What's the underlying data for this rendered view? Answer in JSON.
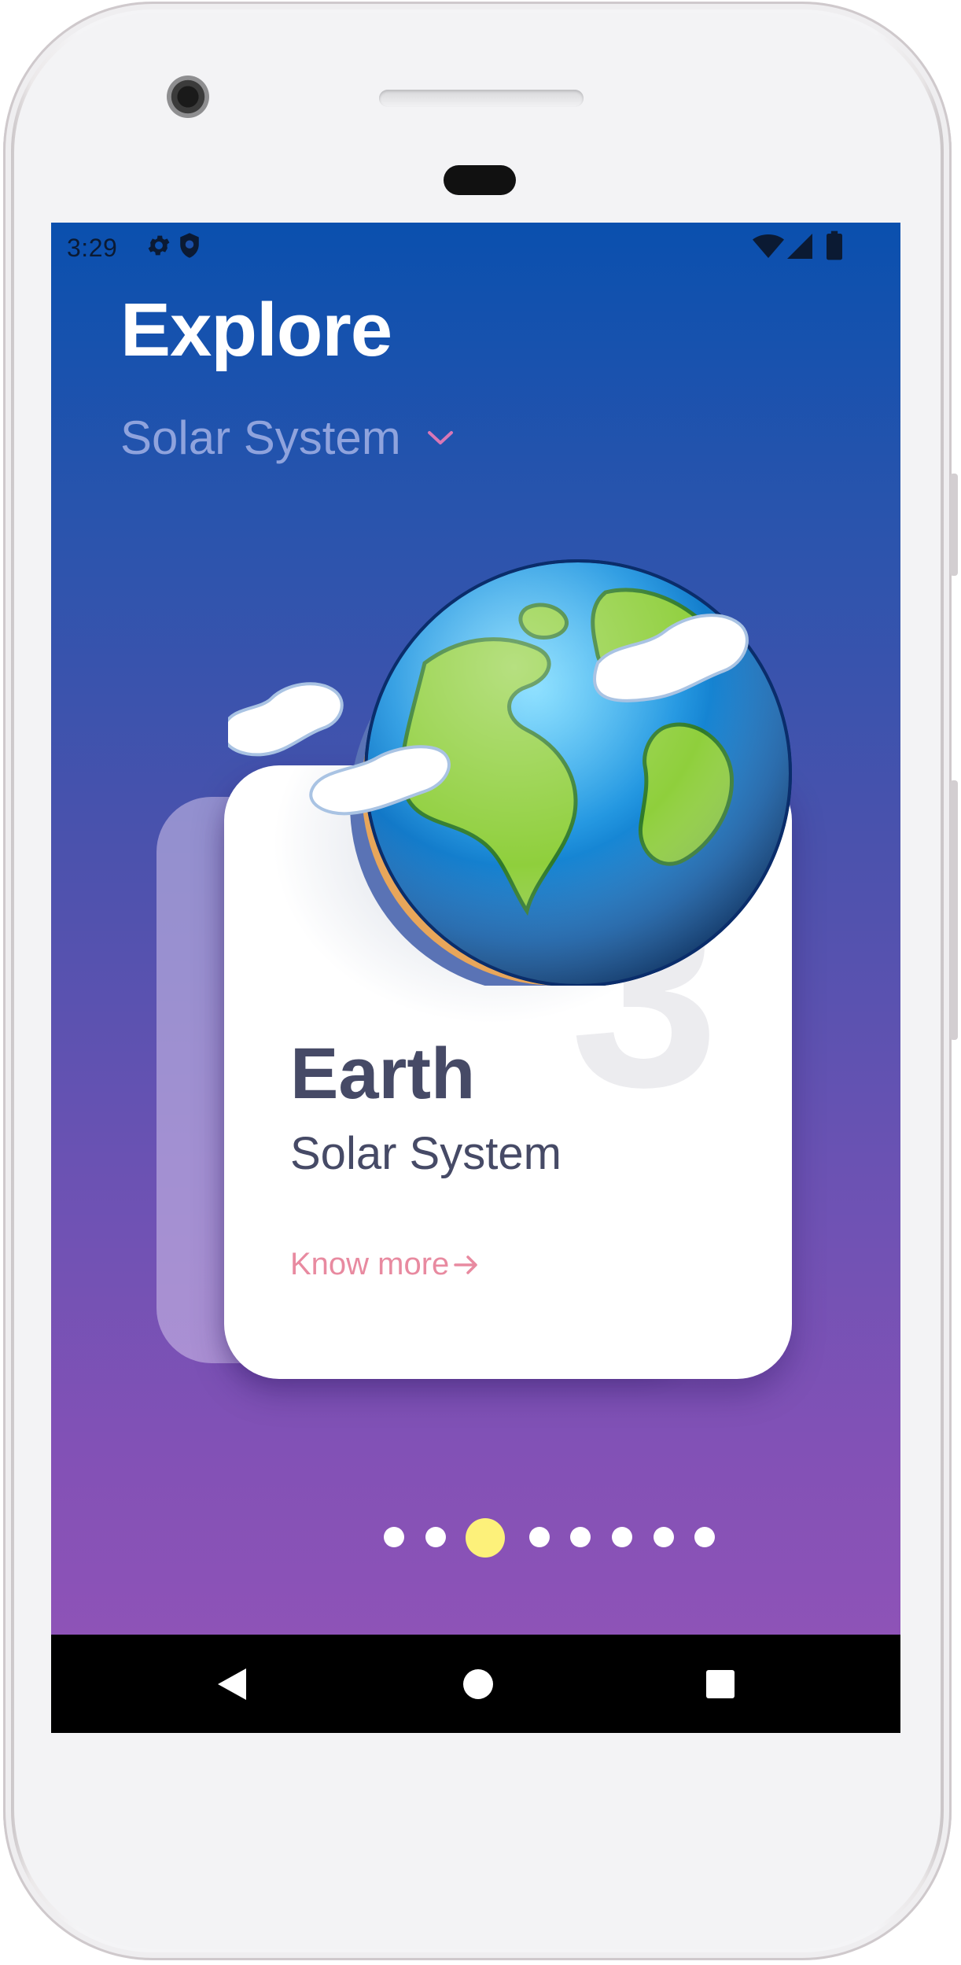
{
  "status_bar": {
    "time": "3:29",
    "left_icons": [
      "gear-icon",
      "shield-icon"
    ],
    "right_icons": [
      "wifi-icon",
      "signal-icon",
      "battery-icon"
    ]
  },
  "header": {
    "title": "Explore",
    "subtitle": "Solar System",
    "dropdown_icon": "chevron-down-icon"
  },
  "card": {
    "number": "3",
    "name": "Earth",
    "subtitle": "Solar System",
    "link_label": "Know more",
    "link_icon": "arrow-right-icon",
    "image": "earth-illustration"
  },
  "pagination": {
    "count": 8,
    "active_index": 2
  },
  "nav_bar": {
    "buttons": [
      "back-icon",
      "home-icon",
      "recents-icon"
    ]
  },
  "colors": {
    "gradient_top": "#0a50ae",
    "gradient_bottom": "#9454b8",
    "accent_pink": "#e88aa0",
    "active_dot": "#fdf17a",
    "card_text": "#464a66"
  }
}
